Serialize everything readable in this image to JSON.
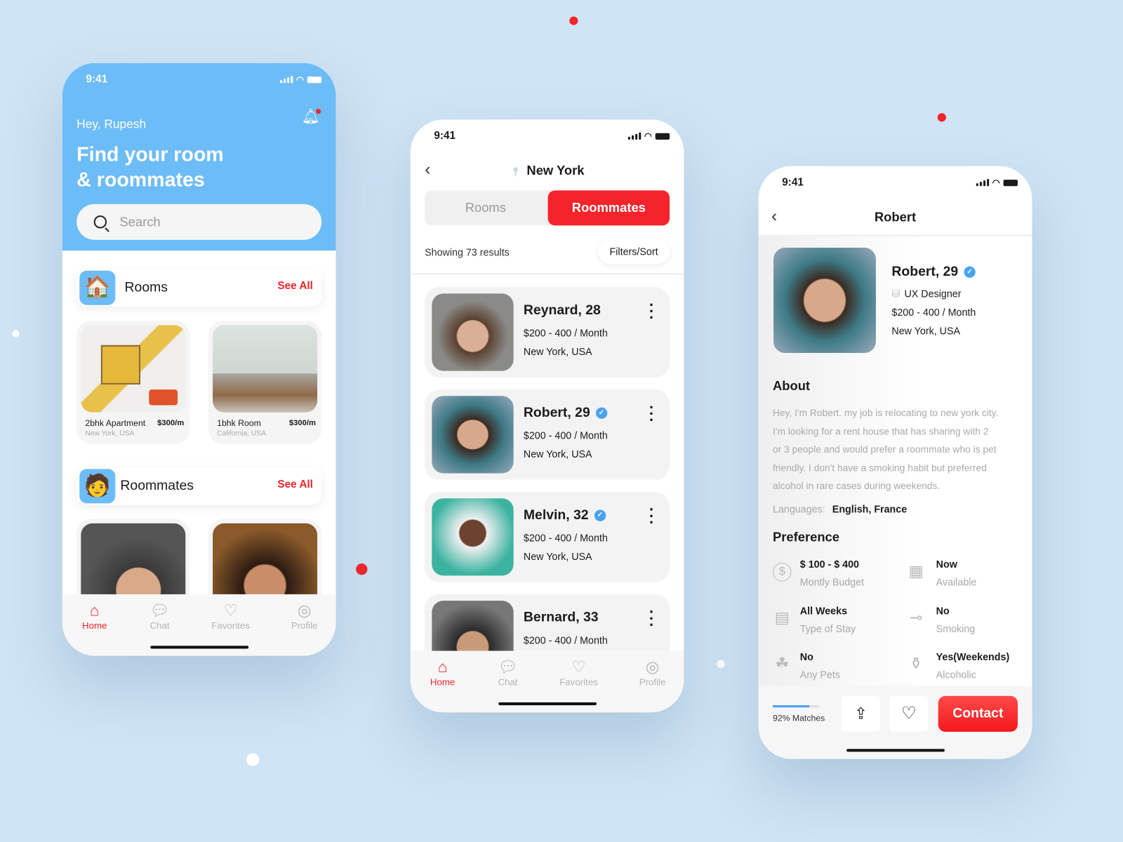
{
  "colors": {
    "accent": "#f5242a",
    "header_blue": "#6cbcf7",
    "verified": "#4aa3f0",
    "background": "#cfe4f4"
  },
  "status_time": "9:41",
  "home": {
    "greeting": "Hey, Rupesh",
    "title_line1": "Find your room",
    "title_line2": "& roommates",
    "search_placeholder": "Search",
    "rooms_section": {
      "title": "Rooms",
      "see_all": "See All"
    },
    "rooms": [
      {
        "name": "2bhk Apartment",
        "price": "$300/m",
        "location": "New York, USA"
      },
      {
        "name": "1bhk Room",
        "price": "$300/m",
        "location": "California, USA"
      }
    ],
    "roommates_section": {
      "title": "Roommates",
      "see_all": "See All"
    }
  },
  "nav": [
    {
      "label": "Home",
      "icon": "home-icon"
    },
    {
      "label": "Chat",
      "icon": "chat-icon"
    },
    {
      "label": "Favorites",
      "icon": "heart-icon"
    },
    {
      "label": "Profile",
      "icon": "profile-icon"
    }
  ],
  "list": {
    "location": "New York",
    "tabs": [
      "Rooms",
      "Roommates"
    ],
    "active_tab": "Roommates",
    "results": "Showing 73 results",
    "filters": "Filters/Sort",
    "people": [
      {
        "name": "Reynard, 28",
        "price": "$200 - 400 / Month",
        "location": "New York, USA",
        "verified": false
      },
      {
        "name": "Robert, 29",
        "price": "$200 - 400 / Month",
        "location": "New York, USA",
        "verified": true
      },
      {
        "name": "Melvin, 32",
        "price": "$200 - 400 / Month",
        "location": "New York, USA",
        "verified": true
      },
      {
        "name": "Bernard, 33",
        "price": "$200 - 400 / Month",
        "location": "",
        "verified": false
      }
    ]
  },
  "profile": {
    "header": "Robert",
    "name": "Robert, 29",
    "job": "UX Designer",
    "price": "$200 - 400 / Month",
    "location": "New York, USA",
    "about_title": "About",
    "about_lines": [
      "Hey, I'm Robert. my job is relocating to new york city.",
      "I'm looking for a rent house that has sharing with 2",
      "or 3 people and would prefer a roommate who is pet",
      "friendly. I don't have a smoking habit but preferred",
      "alcohol in rare cases during weekends."
    ],
    "languages_label": "Languages:",
    "languages": "English, France",
    "preference_title": "Preference",
    "preferences": [
      {
        "value": "$ 100 - $ 400",
        "label": "Montly Budget",
        "icon": "dollar-icon"
      },
      {
        "value": "Now",
        "label": "Available",
        "icon": "calendar-icon"
      },
      {
        "value": "All Weeks",
        "label": "Type of Stay",
        "icon": "calendar-list-icon"
      },
      {
        "value": "No",
        "label": "Smoking",
        "icon": "cigarette-icon"
      },
      {
        "value": "No",
        "label": "Any Pets",
        "icon": "paw-icon"
      },
      {
        "value": "Yes(Weekends)",
        "label": "Alcoholic",
        "icon": "bottle-icon"
      }
    ],
    "match_percent": 92,
    "match_label": "92% Matches",
    "contact": "Contact"
  }
}
